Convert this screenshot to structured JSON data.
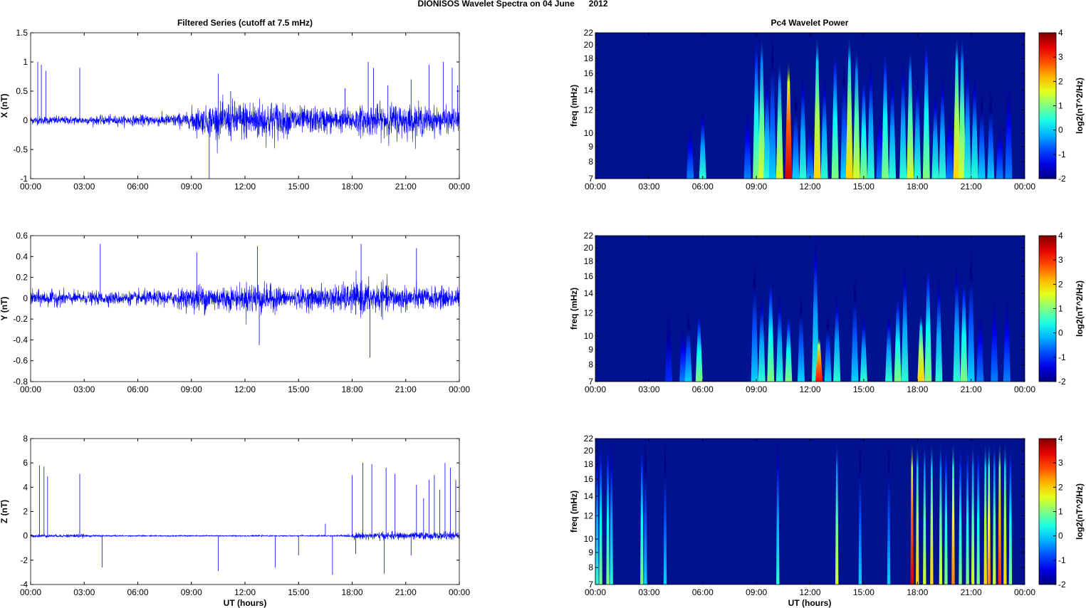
{
  "figure_title": "DIONISOS Wavelet Spectra on 04 June      2012",
  "left_title": "Filtered Series (cutoff at 7.5 mHz)",
  "right_title": "Pc4 Wavelet Power",
  "xlabel": "UT (hours)",
  "time_ticks": [
    "00:00",
    "03:00",
    "06:00",
    "09:00",
    "12:00",
    "15:00",
    "18:00",
    "21:00",
    "00:00"
  ],
  "colors": {
    "trace": "#0000ff",
    "heat_bg": "#00128f"
  },
  "chart_data": [
    {
      "type": "line",
      "name": "X",
      "ylabel": "X (nT)",
      "ylim": [
        -1,
        1.5
      ],
      "yticks": [
        -1,
        -0.5,
        0,
        0.5,
        1,
        1.5
      ],
      "xlim": [
        0,
        24
      ],
      "noise_amplitude_by_hour": [
        0.07,
        0.07,
        0.07,
        0.07,
        0.08,
        0.08,
        0.09,
        0.1,
        0.12,
        0.22,
        0.28,
        0.32,
        0.35,
        0.33,
        0.25,
        0.22,
        0.22,
        0.2,
        0.24,
        0.26,
        0.28,
        0.26,
        0.22,
        0.2
      ],
      "spikes": [
        [
          0.4,
          1.0
        ],
        [
          0.6,
          0.95
        ],
        [
          0.85,
          0.85
        ],
        [
          2.75,
          0.9
        ],
        [
          10.0,
          -1.0
        ],
        [
          10.5,
          0.8
        ],
        [
          11.2,
          0.5
        ],
        [
          17.6,
          0.55
        ],
        [
          18.9,
          1.0
        ],
        [
          19.2,
          0.9
        ],
        [
          20.0,
          0.6
        ],
        [
          21.3,
          0.7
        ],
        [
          22.3,
          0.95
        ],
        [
          23.1,
          1.0
        ],
        [
          23.6,
          0.9
        ],
        [
          23.9,
          0.6
        ]
      ]
    },
    {
      "type": "line",
      "name": "Y",
      "ylabel": "Y (nT)",
      "ylim": [
        -0.8,
        0.6
      ],
      "yticks": [
        -0.8,
        -0.6,
        -0.4,
        -0.2,
        0,
        0.2,
        0.4,
        0.6
      ],
      "xlim": [
        0,
        24
      ],
      "noise_amplitude_by_hour": [
        0.07,
        0.07,
        0.06,
        0.06,
        0.06,
        0.06,
        0.07,
        0.07,
        0.09,
        0.13,
        0.12,
        0.11,
        0.15,
        0.12,
        0.09,
        0.1,
        0.11,
        0.13,
        0.15,
        0.14,
        0.12,
        0.11,
        0.1,
        0.1
      ],
      "spikes": [
        [
          3.9,
          0.52
        ],
        [
          12.7,
          0.5
        ],
        [
          12.8,
          -0.45
        ],
        [
          18.5,
          0.52
        ],
        [
          19.0,
          -0.57
        ],
        [
          21.6,
          0.48
        ],
        [
          9.3,
          0.44
        ]
      ]
    },
    {
      "type": "line",
      "name": "Z",
      "ylabel": "Z (nT)",
      "ylim": [
        -4,
        8
      ],
      "yticks": [
        -4,
        -2,
        0,
        2,
        4,
        6,
        8
      ],
      "xlim": [
        0,
        24
      ],
      "noise_amplitude_by_hour": [
        0.12,
        0.1,
        0.15,
        0.08,
        0.06,
        0.05,
        0.05,
        0.05,
        0.05,
        0.05,
        0.05,
        0.05,
        0.05,
        0.05,
        0.05,
        0.05,
        0.06,
        0.08,
        0.25,
        0.3,
        0.3,
        0.3,
        0.3,
        0.3
      ],
      "spikes": [
        [
          0.5,
          5.8
        ],
        [
          0.75,
          5.7
        ],
        [
          0.95,
          4.9
        ],
        [
          2.75,
          5.1
        ],
        [
          4.0,
          -2.6
        ],
        [
          10.5,
          -2.9
        ],
        [
          13.7,
          -2.6
        ],
        [
          15.0,
          -1.6
        ],
        [
          16.5,
          1.0
        ],
        [
          16.9,
          -3.2
        ],
        [
          18.0,
          5.0
        ],
        [
          18.2,
          -1.5
        ],
        [
          18.6,
          6.0
        ],
        [
          19.1,
          5.9
        ],
        [
          19.8,
          -3.1
        ],
        [
          19.9,
          5.6
        ],
        [
          20.4,
          5.1
        ],
        [
          21.3,
          -1.6
        ],
        [
          21.6,
          4.2
        ],
        [
          22.0,
          3.1
        ],
        [
          22.3,
          4.6
        ],
        [
          22.6,
          5.0
        ],
        [
          22.9,
          3.8
        ],
        [
          23.2,
          6.0
        ],
        [
          23.5,
          5.6
        ],
        [
          23.8,
          4.6
        ]
      ]
    },
    {
      "type": "heatmap",
      "name": "X wavelet power",
      "ylabel": "freq (mHz)",
      "ylim": [
        7,
        22
      ],
      "yscale": "log",
      "yticks": [
        7,
        8,
        9,
        10,
        12,
        14,
        16,
        18,
        20,
        22
      ],
      "clim": [
        -2,
        4
      ],
      "cbar_ticks": [
        -2,
        -1,
        0,
        1,
        2,
        3,
        4
      ],
      "cbar_label": "log2(nT^2/Hz)",
      "bursts_hour_power_topfreq": [
        [
          5.3,
          -0.5,
          12
        ],
        [
          6.0,
          0.5,
          12
        ],
        [
          8.5,
          -0.5,
          14
        ],
        [
          9.0,
          1,
          22
        ],
        [
          9.3,
          1.5,
          22
        ],
        [
          9.6,
          0.5,
          16
        ],
        [
          9.9,
          0,
          22
        ],
        [
          10.3,
          1.5,
          18
        ],
        [
          10.8,
          3.5,
          18
        ],
        [
          11.2,
          0,
          14
        ],
        [
          11.6,
          0.5,
          16
        ],
        [
          12.0,
          -0.3,
          12
        ],
        [
          12.4,
          2,
          22
        ],
        [
          12.8,
          0.5,
          16
        ],
        [
          13.4,
          1,
          20
        ],
        [
          13.9,
          0,
          18
        ],
        [
          14.2,
          2,
          22
        ],
        [
          14.6,
          1.5,
          20
        ],
        [
          15.0,
          1,
          16
        ],
        [
          15.4,
          0.5,
          18
        ],
        [
          15.9,
          -0.5,
          14
        ],
        [
          16.2,
          1,
          20
        ],
        [
          16.6,
          0.5,
          16
        ],
        [
          17.2,
          0.5,
          18
        ],
        [
          17.6,
          1.5,
          20
        ],
        [
          18.0,
          0.5,
          16
        ],
        [
          18.5,
          1,
          22
        ],
        [
          19.0,
          0.5,
          14
        ],
        [
          19.4,
          0.5,
          16
        ],
        [
          19.8,
          -0.5,
          14
        ],
        [
          20.2,
          2,
          22
        ],
        [
          20.5,
          1.5,
          22
        ],
        [
          20.8,
          0.5,
          18
        ],
        [
          21.2,
          0.5,
          16
        ],
        [
          21.6,
          0,
          14
        ],
        [
          22.1,
          0,
          14
        ],
        [
          22.6,
          -0.5,
          12
        ],
        [
          23.1,
          -0.5,
          18
        ]
      ]
    },
    {
      "type": "heatmap",
      "name": "Y wavelet power",
      "ylabel": "freq (mHz)",
      "ylim": [
        7,
        22
      ],
      "yscale": "log",
      "yticks": [
        7,
        8,
        9,
        10,
        12,
        14,
        16,
        18,
        20,
        22
      ],
      "clim": [
        -2,
        4
      ],
      "cbar_ticks": [
        -2,
        -1,
        0,
        1,
        2,
        3,
        4
      ],
      "cbar_label": "log2(nT^2/Hz)",
      "bursts_hour_power_topfreq": [
        [
          4.1,
          -1,
          14
        ],
        [
          4.9,
          -0.5,
          12
        ],
        [
          5.2,
          0,
          12
        ],
        [
          5.8,
          1,
          12
        ],
        [
          8.9,
          0,
          18
        ],
        [
          9.3,
          0.5,
          14
        ],
        [
          9.8,
          1,
          16
        ],
        [
          10.3,
          0.5,
          14
        ],
        [
          10.8,
          1,
          12
        ],
        [
          11.5,
          0,
          14
        ],
        [
          12.3,
          0.5,
          22
        ],
        [
          12.5,
          3.2,
          10
        ],
        [
          13.0,
          0,
          12
        ],
        [
          13.5,
          0.5,
          14
        ],
        [
          14.5,
          0,
          16
        ],
        [
          15.0,
          0.5,
          12
        ],
        [
          16.4,
          0.5,
          12
        ],
        [
          16.9,
          1,
          14
        ],
        [
          17.3,
          0.5,
          18
        ],
        [
          18.2,
          2,
          12
        ],
        [
          18.6,
          1,
          18
        ],
        [
          19.2,
          0.5,
          16
        ],
        [
          20.2,
          0.5,
          18
        ],
        [
          20.6,
          1,
          16
        ],
        [
          21.0,
          0,
          20
        ],
        [
          21.5,
          -0.5,
          14
        ],
        [
          22.3,
          -0.5,
          16
        ],
        [
          23.0,
          -0.5,
          16
        ]
      ]
    },
    {
      "type": "heatmap",
      "name": "Z wavelet power",
      "ylabel": "freq (mHz)",
      "ylim": [
        7,
        22
      ],
      "yscale": "log",
      "yticks": [
        7,
        8,
        9,
        10,
        12,
        14,
        16,
        18,
        20,
        22
      ],
      "clim": [
        -2,
        4
      ],
      "cbar_ticks": [
        -2,
        -1,
        0,
        1,
        2,
        3,
        4
      ],
      "cbar_label": "log2(nT^2/Hz)",
      "bursts_hour_power_topfreq": [
        [
          0.1,
          0.5,
          22
        ],
        [
          0.3,
          1,
          22
        ],
        [
          0.7,
          1,
          22
        ],
        [
          0.9,
          0.5,
          22
        ],
        [
          2.6,
          1,
          22
        ],
        [
          2.8,
          0,
          22
        ],
        [
          3.9,
          0,
          22
        ],
        [
          10.2,
          0.5,
          22
        ],
        [
          13.5,
          1.5,
          22
        ],
        [
          14.8,
          0,
          22
        ],
        [
          16.4,
          0,
          22
        ],
        [
          17.7,
          3.5,
          22
        ],
        [
          18.0,
          2,
          22
        ],
        [
          18.4,
          1.5,
          22
        ],
        [
          18.8,
          2,
          22
        ],
        [
          19.3,
          1.5,
          22
        ],
        [
          19.6,
          1,
          22
        ],
        [
          20.0,
          2.5,
          22
        ],
        [
          20.4,
          1,
          22
        ],
        [
          20.8,
          1,
          22
        ],
        [
          21.1,
          1.5,
          22
        ],
        [
          21.4,
          1,
          22
        ],
        [
          21.8,
          2,
          22
        ],
        [
          22.0,
          2.5,
          22
        ],
        [
          22.3,
          1.5,
          22
        ],
        [
          22.6,
          3,
          22
        ],
        [
          22.9,
          2,
          22
        ],
        [
          23.2,
          1,
          22
        ]
      ]
    }
  ]
}
